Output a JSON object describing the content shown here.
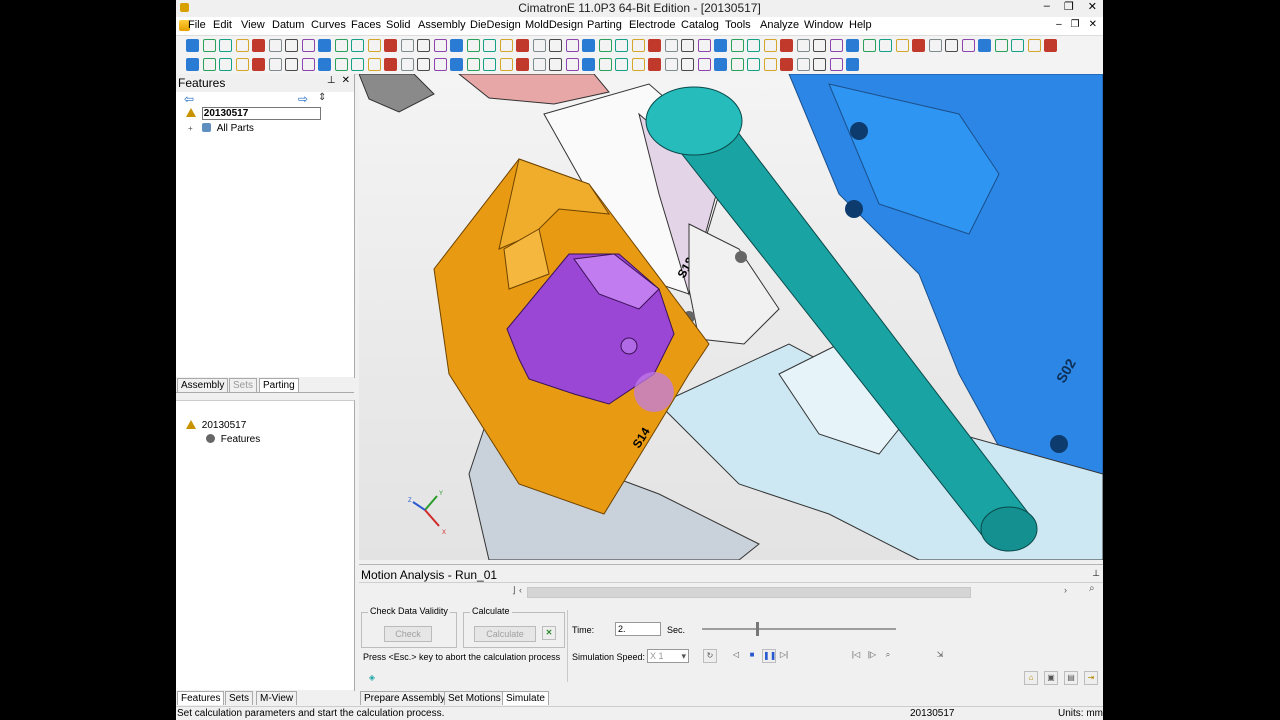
{
  "window": {
    "title": "CimatronE 11.0P3 64-Bit Edition - [20130517]",
    "controls": [
      "–",
      "❐",
      "✕"
    ]
  },
  "menu": {
    "items": [
      "File",
      "Edit",
      "View",
      "Datum",
      "Curves",
      "Faces",
      "Solid",
      "Assembly",
      "DieDesign",
      "MoldDesign",
      "Parting",
      "Electrode",
      "Catalog",
      "Tools",
      "Analyze",
      "Window",
      "Help"
    ],
    "mdi_controls": [
      "–",
      "❐",
      "✕"
    ]
  },
  "features_panel": {
    "title": "Features",
    "tree_root": "20130517",
    "tree_child": "All Parts",
    "tabs": [
      "Assembly",
      "Sets",
      "Parting"
    ]
  },
  "second_panel": {
    "tree_root": "20130517",
    "tree_child": "Features"
  },
  "bottom_left_tabs": [
    "Features",
    "Sets",
    "M-View"
  ],
  "viewport": {
    "part_labels": [
      "S18",
      "S14",
      "S02"
    ],
    "axis_labels": {
      "x": "X",
      "y": "Y",
      "z": "Z"
    }
  },
  "motion": {
    "title": "Motion Analysis - Run_01",
    "check_group": "Check Data Validity",
    "check_button": "Check",
    "calculate_group": "Calculate",
    "calculate_button": "Calculate",
    "hint": "Press <Esc.> key to abort the calculation process",
    "time_label": "Time:",
    "time_value": "2.",
    "sec_label": "Sec.",
    "speed_label": "Simulation Speed:",
    "speed_value": "X 1",
    "time_slider_fraction": 0.28,
    "tabs": [
      "Prepare Assembly",
      "Set Motions",
      "Simulate"
    ]
  },
  "status": {
    "message": "Set calculation parameters and start the calculation process.",
    "file": "20130517",
    "units": "Units: mm"
  },
  "colors": {
    "orange_part": "#e89a13",
    "purple_part": "#9b47d6",
    "teal_pin": "#1aa3a3",
    "blue_block": "#2b86e6",
    "light_block": "#c9e6f2"
  }
}
